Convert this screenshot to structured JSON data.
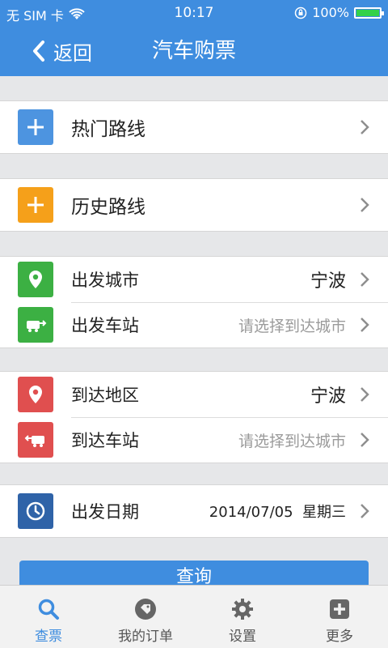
{
  "status_bar": {
    "carrier": "无 SIM 卡",
    "time": "10:17",
    "battery": "100%"
  },
  "nav": {
    "back_label": "返回",
    "title": "汽车购票"
  },
  "rows": {
    "hot_routes": {
      "label": "热门路线"
    },
    "history_routes": {
      "label": "历史路线"
    },
    "departure_city": {
      "label": "出发城市",
      "value": "宁波"
    },
    "departure_station": {
      "label": "出发车站",
      "value": "请选择到达城市"
    },
    "arrival_area": {
      "label": "到达地区",
      "value": "宁波"
    },
    "arrival_station": {
      "label": "到达车站",
      "value": "请选择到达城市"
    },
    "departure_date": {
      "label": "出发日期",
      "value": "2014/07/05  星期三"
    }
  },
  "query_button": {
    "label": "查询"
  },
  "tabbar": {
    "items": [
      {
        "label": "查票",
        "icon": "search-icon",
        "active": true
      },
      {
        "label": "我的订单",
        "icon": "tag-icon",
        "active": false
      },
      {
        "label": "设置",
        "icon": "gear-icon",
        "active": false
      },
      {
        "label": "更多",
        "icon": "plus-square-icon",
        "active": false
      }
    ]
  },
  "colors": {
    "primary": "#3f8ddf",
    "hot_routes_icon": "#4d94e0",
    "history_icon": "#f5a01a",
    "departure_icon": "#3cb043",
    "arrival_icon": "#e04f4f",
    "date_icon": "#2f63a8"
  }
}
